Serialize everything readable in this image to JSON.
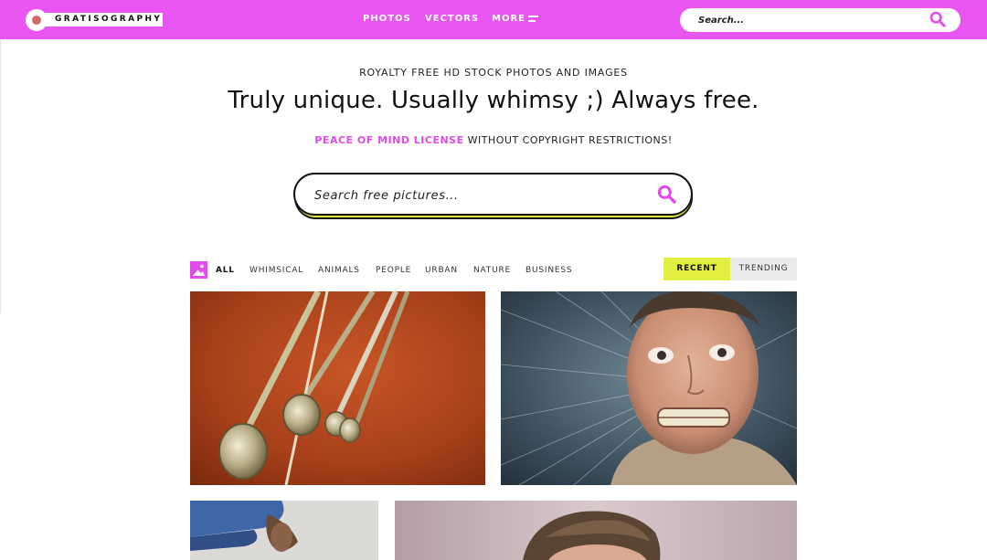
{
  "header": {
    "logo_text": "GRATISOGRAPHY",
    "nav": [
      {
        "label": "PHOTOS"
      },
      {
        "label": "VECTORS"
      },
      {
        "label": "MORE"
      }
    ],
    "search_placeholder": "Search...",
    "background_color": "#e855f1"
  },
  "hero": {
    "eyebrow": "ROYALTY FREE HD STOCK PHOTOS AND IMAGES",
    "title": "Truly unique. Usually whimsy ;) Always free.",
    "license_link": "PEACE OF MIND LICENSE",
    "license_text": " WITHOUT COPYRIGHT RESTRICTIONS!",
    "search_placeholder": "Search free pictures..."
  },
  "filters": {
    "categories": [
      "ALL",
      "WHIMSICAL",
      "ANIMALS",
      "PEOPLE",
      "URBAN",
      "NATURE",
      "BUSINESS"
    ],
    "active": "ALL",
    "sort": [
      {
        "label": "RECENT",
        "active": true
      },
      {
        "label": "TRENDING",
        "active": false
      }
    ]
  },
  "colors": {
    "accent": "#e04ce8",
    "highlight": "#e3ee43"
  },
  "photos": [
    {
      "subject": "measuring spoons on orange background"
    },
    {
      "subject": "man with grimacing face"
    },
    {
      "subject": "person in jeans crouching"
    },
    {
      "subject": "man with styled hair"
    }
  ]
}
